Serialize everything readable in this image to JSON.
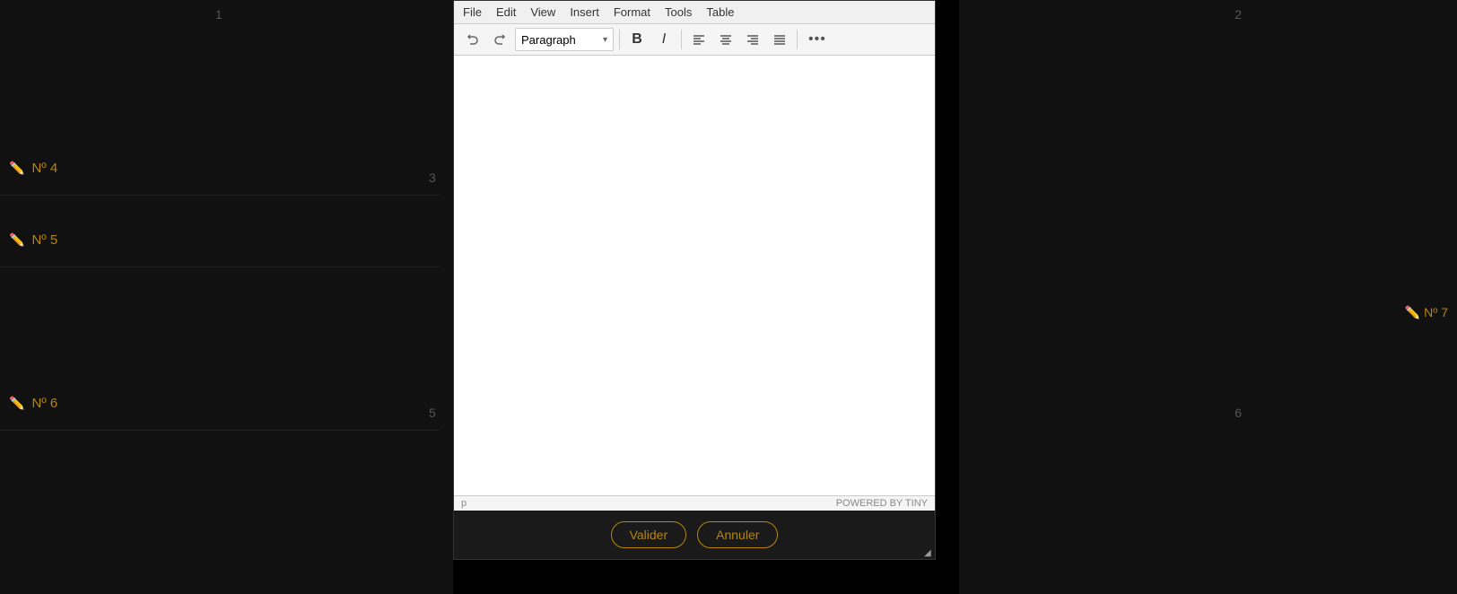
{
  "background": {
    "color": "#000"
  },
  "corners": {
    "top_left": "1",
    "top_right": "2",
    "mid_left": "3",
    "mid_center_left": "5",
    "mid_right": "6",
    "bottom_right_far": "6"
  },
  "left_panel": {
    "items": [
      {
        "id": "4",
        "label": "Nº 4"
      },
      {
        "id": "5",
        "label": "Nº 5"
      },
      {
        "id": "6",
        "label": "Nº 6"
      }
    ]
  },
  "right_panel": {
    "item": {
      "label": "Nº 7"
    }
  },
  "editor": {
    "menubar": {
      "items": [
        "File",
        "Edit",
        "View",
        "Insert",
        "Format",
        "Tools",
        "Table"
      ]
    },
    "toolbar": {
      "undo_label": "↩",
      "redo_label": "↪",
      "paragraph_label": "Paragraph",
      "paragraph_arrow": "▾",
      "bold_label": "B",
      "italic_label": "I",
      "align_left": "≡",
      "align_center": "≡",
      "align_right": "≡",
      "align_justify": "≡",
      "more_label": "•••"
    },
    "statusbar": {
      "path": "p",
      "powered_by": "POWERED BY TINY"
    }
  },
  "buttons": {
    "valider": "Valider",
    "annuler": "Annuler"
  }
}
